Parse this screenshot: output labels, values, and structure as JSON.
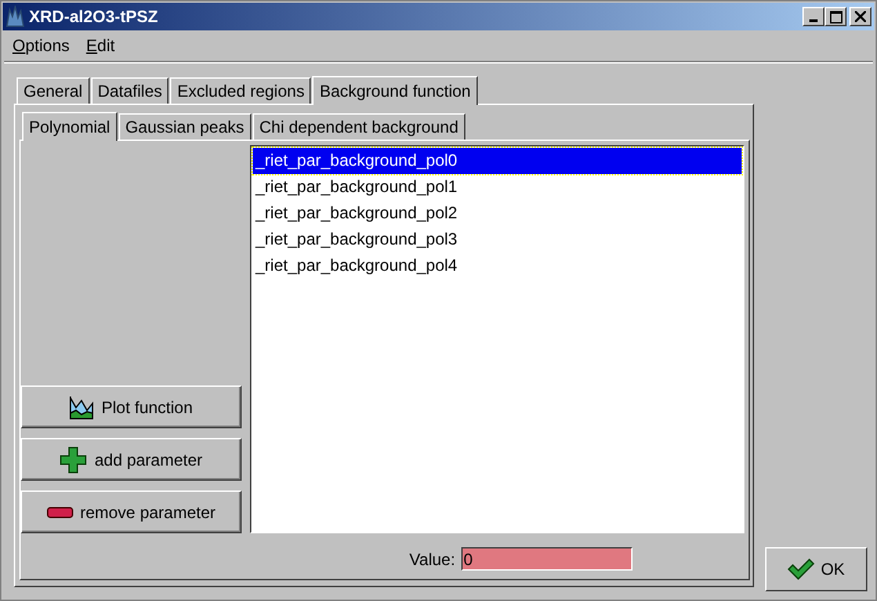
{
  "window": {
    "title": "XRD-al2O3-tPSZ"
  },
  "menu": [
    "Options",
    "Edit"
  ],
  "tabs": [
    {
      "label": "General",
      "selected": false
    },
    {
      "label": "Datafiles",
      "selected": false
    },
    {
      "label": "Excluded regions",
      "selected": false
    },
    {
      "label": "Background function",
      "selected": true
    }
  ],
  "subtabs": [
    {
      "label": "Polynomial",
      "selected": true
    },
    {
      "label": "Gaussian peaks",
      "selected": false
    },
    {
      "label": "Chi dependent background",
      "selected": false
    }
  ],
  "parameters": [
    {
      "label": "_riet_par_background_pol0",
      "selected": true
    },
    {
      "label": "_riet_par_background_pol1",
      "selected": false
    },
    {
      "label": "_riet_par_background_pol2",
      "selected": false
    },
    {
      "label": "_riet_par_background_pol3",
      "selected": false
    },
    {
      "label": "_riet_par_background_pol4",
      "selected": false
    }
  ],
  "buttons": [
    {
      "kind": "plot",
      "label": "Plot function"
    },
    {
      "kind": "add",
      "label": "add parameter"
    },
    {
      "kind": "remove",
      "label": "remove parameter"
    }
  ],
  "value": {
    "label": "Value:",
    "value": "0"
  },
  "ok": {
    "label": "OK"
  }
}
